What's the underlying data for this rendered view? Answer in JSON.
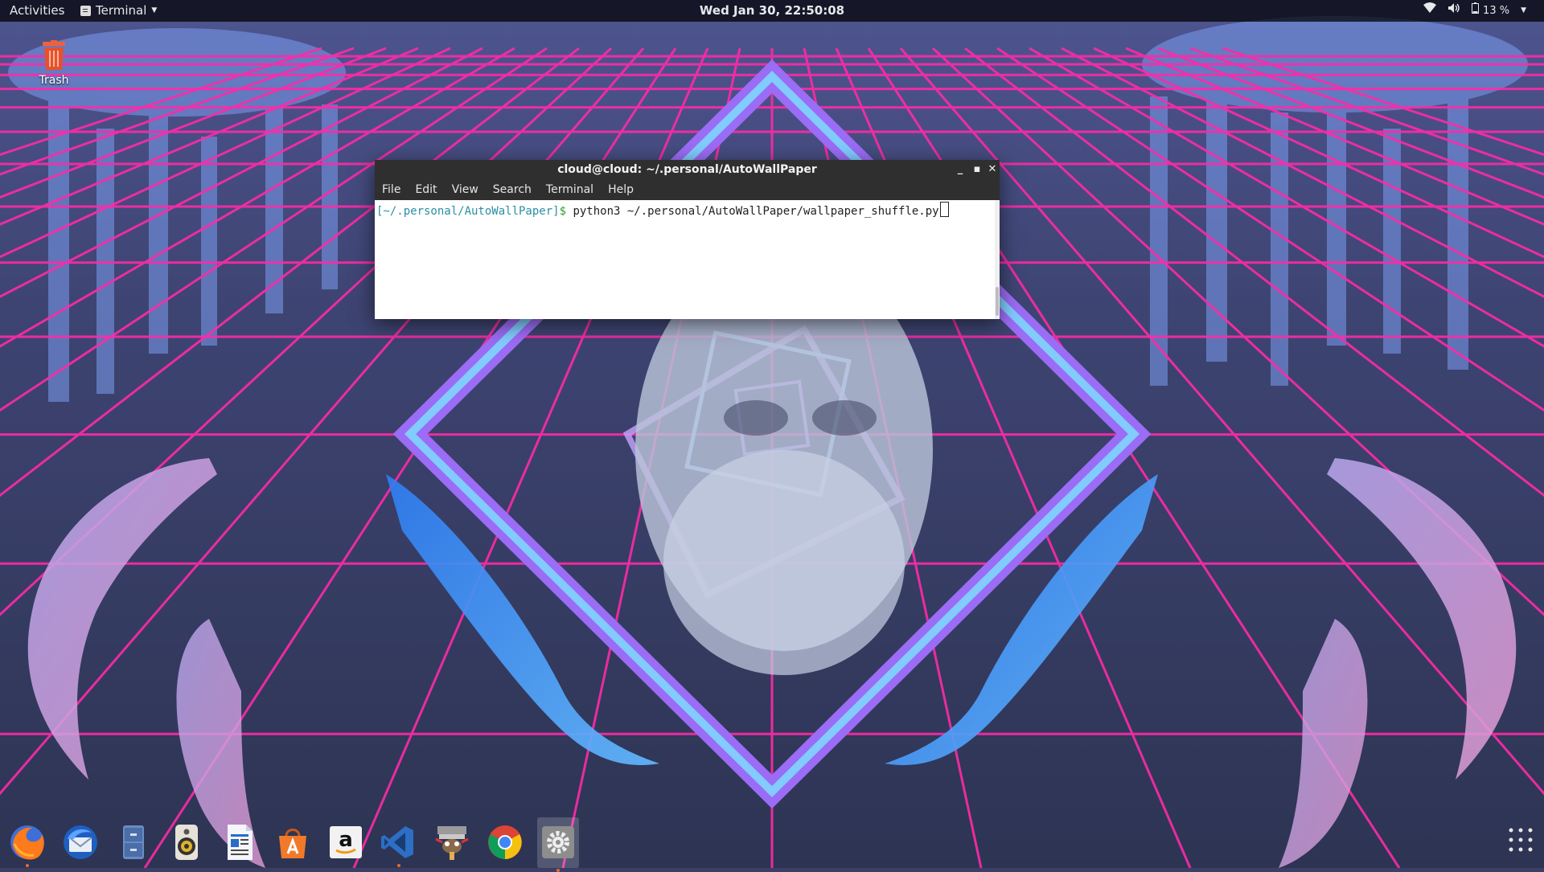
{
  "topbar": {
    "activities": "Activities",
    "app_menu": "Terminal",
    "clock": "Wed Jan 30, 22:50:08",
    "battery": "13 %",
    "icons": [
      "wifi-icon",
      "volume-icon",
      "battery-icon"
    ]
  },
  "desktop": {
    "icons": [
      {
        "label": "Trash",
        "icon": "trash-icon"
      }
    ]
  },
  "terminal": {
    "title": "cloud@cloud: ~/.personal/AutoWallPaper",
    "window_buttons": [
      "minimize",
      "maximize",
      "close"
    ],
    "menu": [
      "File",
      "Edit",
      "View",
      "Search",
      "Terminal",
      "Help"
    ],
    "prompt_path": "[~/.personal/AutoWallPaper]",
    "prompt_sign": "$",
    "command": " python3 ~/.personal/AutoWallPaper/wallpaper_shuffle.py"
  },
  "dock": {
    "items": [
      {
        "name": "firefox",
        "running": true
      },
      {
        "name": "thunderbird",
        "running": false
      },
      {
        "name": "files",
        "running": false
      },
      {
        "name": "rhythmbox",
        "running": false
      },
      {
        "name": "libreoffice-writer",
        "running": false
      },
      {
        "name": "ubuntu-software",
        "running": false
      },
      {
        "name": "amazon",
        "running": false
      },
      {
        "name": "vscode",
        "running": true
      },
      {
        "name": "gimp",
        "running": false
      },
      {
        "name": "chrome",
        "running": false
      },
      {
        "name": "settings",
        "running": true
      }
    ],
    "app_grid": "show-applications"
  },
  "colors": {
    "topbar_bg": "#000000",
    "terminal_chrome": "#2f2f2f",
    "prompt_path": "#2a8fa3",
    "prompt_sign": "#2f9d2f",
    "grid_line": "#ff2aa8",
    "wallpaper_sky": "#4a4f86"
  }
}
